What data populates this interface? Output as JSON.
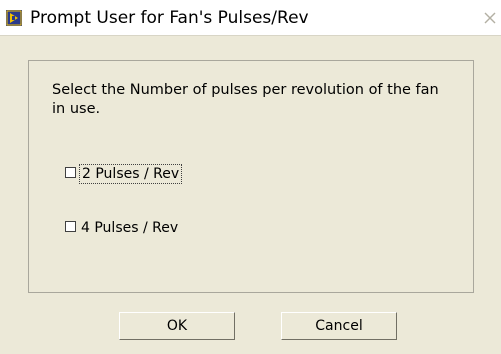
{
  "window": {
    "title": "Prompt User for Fan's Pulses/Rev"
  },
  "prompt": {
    "message": "Select the Number of pulses per revolution of the fan\nin use."
  },
  "options": [
    {
      "label": "2 Pulses / Rev",
      "checked": false
    },
    {
      "label": "4 Pulses / Rev",
      "checked": false
    }
  ],
  "buttons": {
    "ok_label": "OK",
    "cancel_label": "Cancel"
  },
  "icons": {
    "app": "labview-vi-icon",
    "close": "close-icon"
  },
  "colors": {
    "dialog_background": "#ece9d8",
    "titlebar_background": "#ffffff",
    "app_icon_background": "#2a3a8c",
    "app_icon_accent": "#f2c200"
  }
}
